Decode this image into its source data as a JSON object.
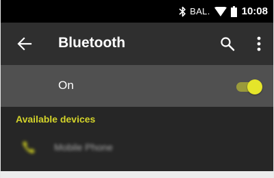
{
  "status_bar": {
    "carrier": "BAL.",
    "time": "10:08",
    "icons": [
      "bluetooth-icon",
      "wifi-icon",
      "battery-icon"
    ]
  },
  "app_bar": {
    "title": "Bluetooth",
    "icons": [
      "back-arrow-icon",
      "search-icon",
      "more-vert-icon"
    ]
  },
  "bluetooth_toggle": {
    "label": "On",
    "enabled": true
  },
  "available_devices": {
    "header": "Available devices",
    "items": [
      {
        "name": "Mobile Phone",
        "icon": "phone-icon"
      }
    ]
  },
  "colors": {
    "accent": "#d4d42a",
    "switch_thumb": "#e5e52a",
    "switch_track": "#9a9a3c",
    "toolbar": "#2f2f2f",
    "toggle_row": "#505050",
    "background": "#262626"
  }
}
